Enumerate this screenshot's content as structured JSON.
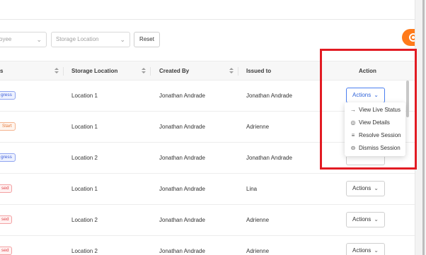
{
  "filters": {
    "employee_placeholder": "oyee",
    "storage_placeholder": "Storage Location",
    "reset_label": "Reset"
  },
  "table": {
    "columns": [
      "s",
      "Storage Location",
      "Created By",
      "Issued to",
      "Action"
    ],
    "rows": [
      {
        "status": "gress",
        "status_color": "blue",
        "location": "Location 1",
        "created_by": "Jonathan Andrade",
        "issued_to": "Jonathan Andrade",
        "action": "Actions"
      },
      {
        "status": "Start",
        "status_color": "orange",
        "location": "Location 1",
        "created_by": "Jonathan Andrade",
        "issued_to": "Adrienne",
        "action": ""
      },
      {
        "status": "gress",
        "status_color": "blue",
        "location": "Location 2",
        "created_by": "Jonathan Andrade",
        "issued_to": "Jonathan Andrade",
        "action": ""
      },
      {
        "status": "sed",
        "status_color": "red",
        "location": "Location 1",
        "created_by": "Jonathan Andrade",
        "issued_to": "Lina",
        "action": "Actions"
      },
      {
        "status": "sed",
        "status_color": "red",
        "location": "Location 2",
        "created_by": "Jonathan Andrade",
        "issued_to": "Adrienne",
        "action": "Actions"
      },
      {
        "status": "sed",
        "status_color": "red",
        "location": "Location 2",
        "created_by": "Jonathan Andrade",
        "issued_to": "Adrienne",
        "action": "Actions"
      }
    ]
  },
  "dropdown": {
    "items": [
      {
        "label": "View Live Status",
        "icon": "arrow-right-icon"
      },
      {
        "label": "View Details",
        "icon": "eye-icon"
      },
      {
        "label": "Resolve Session",
        "icon": "list-check-icon"
      },
      {
        "label": "Dismiss Session",
        "icon": "circle-minus-icon"
      }
    ]
  },
  "colors": {
    "accent": "#2f63d9",
    "fab": "#ff7a1a",
    "highlight": "#e21b23"
  }
}
